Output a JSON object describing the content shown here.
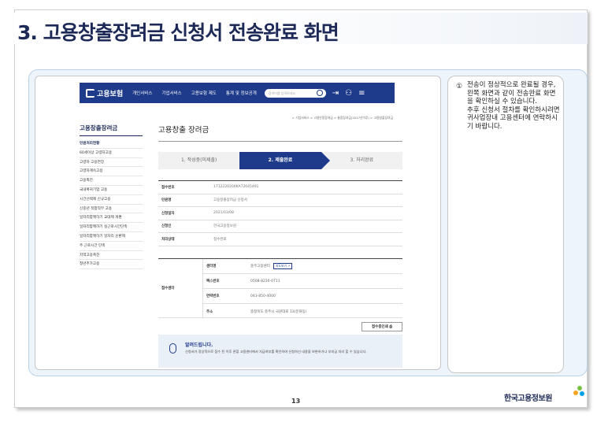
{
  "slide": {
    "title": "3. 고용창출장려금 신청서 전송완료 화면",
    "page_number": "13",
    "brand": "한국고용정보원"
  },
  "site": {
    "logo_text": "고용보험",
    "nav": [
      "개인서비스",
      "기업서비스",
      "고용보험 제도",
      "통계 및 정보공개"
    ],
    "search_placeholder": "검색어를 입력하세요",
    "breadcrumb": "> 기업서비스 > 고용안정장려금 > 통합장려금(2017년이후) > 고용창출장려금"
  },
  "sidebar": {
    "title": "고용창출장려금",
    "items": [
      "민원처리현황",
      "60세이상 고령자고용",
      "고령자 고용연장",
      "고령자계속고용",
      "고용촉진",
      "국내복귀기업 고용",
      "시간선택제 신규고용",
      "신중년 적합직무 고용",
      "일자리함께하기 교대제 개편",
      "일자리함께하기 실근로시간단축",
      "일자리함께하기 일자리 순환제",
      "주 근로시간 단축",
      "지역고용촉진",
      "청년추가고용"
    ]
  },
  "main": {
    "title": "고용창출 장려금",
    "steps": [
      "1. 작성중(미제출)",
      "2. 제출완료",
      "3. 처리완료"
    ],
    "info": [
      {
        "k": "접수번호",
        "v": "1712220200KA72045491"
      },
      {
        "k": "민원명",
        "v": "고용창출장려금 신청서"
      },
      {
        "k": "신청일자",
        "v": "2021/03/08"
      },
      {
        "k": "신청인",
        "v": "한국고용정보원"
      },
      {
        "k": "처리상태",
        "v": "접수완료"
      }
    ],
    "center": {
      "label": "접수센터",
      "rows": [
        {
          "k": "센터명",
          "v": "충주고용센터"
        },
        {
          "k": "팩스번호",
          "v": "0508-8230-0711"
        },
        {
          "k": "연락번호",
          "v": "043-850-4000"
        },
        {
          "k": "주소",
          "v": "충청북도 충주시 국원대로 13(문화동)"
        }
      ],
      "map_button": "지도보기"
    },
    "share_button": "접수증인쇄",
    "notice": {
      "title": "알려드립니다.",
      "body": "신청서가 정상적으로 접수 된 이후 관할 고용센터에서 지급여부를 확인하여 신청하신 내용을 보완하거나 부지급 처리 할 수 있습니다."
    }
  },
  "note": {
    "number": "①",
    "text": "전송이 정상적으로 완료될 경우, 왼쪽 화면과 같이 전송완료 화면을 확인하실 수 있습니다.\n추후 신청서 절차를 확인하시려면 귀사업장내 고용센터에 연락하시기 바랍니다."
  }
}
